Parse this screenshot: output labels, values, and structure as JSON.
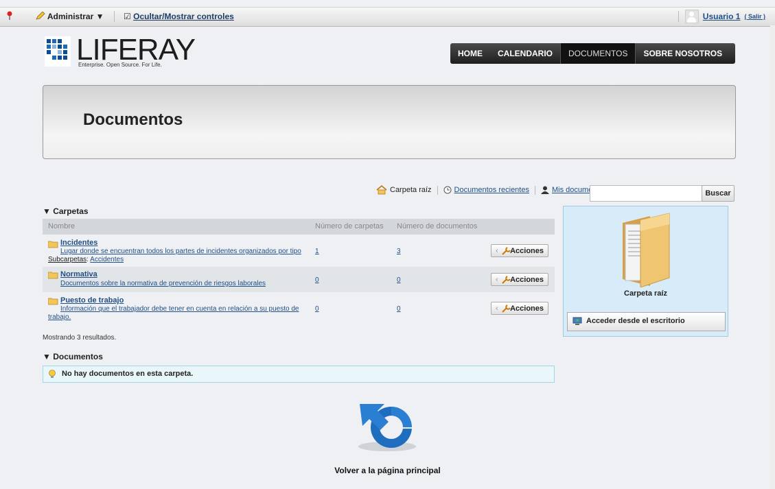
{
  "dockbar": {
    "admin_label": "Administrar ▼",
    "toggle_label": "Ocultar/Mostrar controles",
    "user_name": "Usuario 1",
    "logout_label": "( Salir )"
  },
  "logo": {
    "text": "LIFERAY",
    "tagline": "Enterprise. Open Source. For Life."
  },
  "nav": {
    "items": [
      "HOME",
      "CALENDARIO",
      "DOCUMENTOS",
      "SOBRE NOSOTROS"
    ],
    "active": "DOCUMENTOS"
  },
  "banner": {
    "title": "Documentos"
  },
  "toolbar": {
    "root_label": "Carpeta raíz",
    "recent_label": "Documentos recientes",
    "mine_label": "Mis documentos",
    "search_placeholder": "",
    "search_button": "Buscar"
  },
  "folders": {
    "section_title": "▼ Carpetas",
    "columns": [
      "Nombre",
      "Número de carpetas",
      "Número de documentos"
    ],
    "rows": [
      {
        "name": "Incidentes",
        "description": "Lugar donde se encuentran todos los partes de incidentes organizados por tipo",
        "subfolders_label": "Subcarpetas",
        "subfolders": "Accidentes",
        "folder_count": "1",
        "doc_count": "3",
        "action": "Acciones"
      },
      {
        "name": "Normativa",
        "description": "Documentos sobre la normativa de prevención de riesgos laborales",
        "folder_count": "0",
        "doc_count": "0",
        "action": "Acciones"
      },
      {
        "name": "Puesto de trabajo",
        "description": "Información que el trabajador debe tener en cuenta en relación a su puesto de",
        "description2": "trabajo.",
        "folder_count": "0",
        "doc_count": "0",
        "action": "Acciones"
      }
    ],
    "results_text": "Mostrando 3 resultados."
  },
  "documents": {
    "section_title": "▼ Documentos",
    "empty_message": "No hay documentos en esta carpeta."
  },
  "panel": {
    "caption": "Carpeta raíz",
    "desktop_button": "Acceder desde el escritorio"
  },
  "back": {
    "label": "Volver a la página principal"
  }
}
